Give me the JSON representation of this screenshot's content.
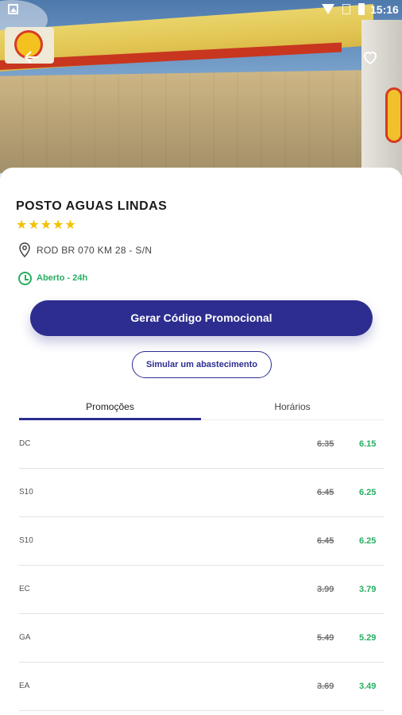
{
  "status_bar": {
    "time": "15:16"
  },
  "station": {
    "name": "POSTO AGUAS LINDAS",
    "rating": "★★★★★",
    "address": "ROD BR 070 KM 28 - S/N",
    "hours": "Aberto - 24h"
  },
  "actions": {
    "promo_button": "Gerar Código Promocional",
    "simulate_button": "Simular um abastecimento"
  },
  "tabs": [
    {
      "label": "Promoções",
      "active": true
    },
    {
      "label": "Horários",
      "active": false
    }
  ],
  "prices": [
    {
      "name": "DC",
      "old": "6.35",
      "new": "6.15"
    },
    {
      "name": "S10",
      "old": "6.45",
      "new": "6.25"
    },
    {
      "name": "S10",
      "old": "6.45",
      "new": "6.25"
    },
    {
      "name": "EC",
      "old": "3.99",
      "new": "3.79"
    },
    {
      "name": "GA",
      "old": "5.49",
      "new": "5.29"
    },
    {
      "name": "EA",
      "old": "3.69",
      "new": "3.49"
    }
  ],
  "colors": {
    "primary": "#2c2d8f",
    "discount": "#27ae60",
    "stars": "#f2c100"
  },
  "icons": {
    "back": "arrow-left-icon",
    "favorite": "heart-outline-icon",
    "address": "map-pin-icon",
    "hours": "clock-icon"
  }
}
